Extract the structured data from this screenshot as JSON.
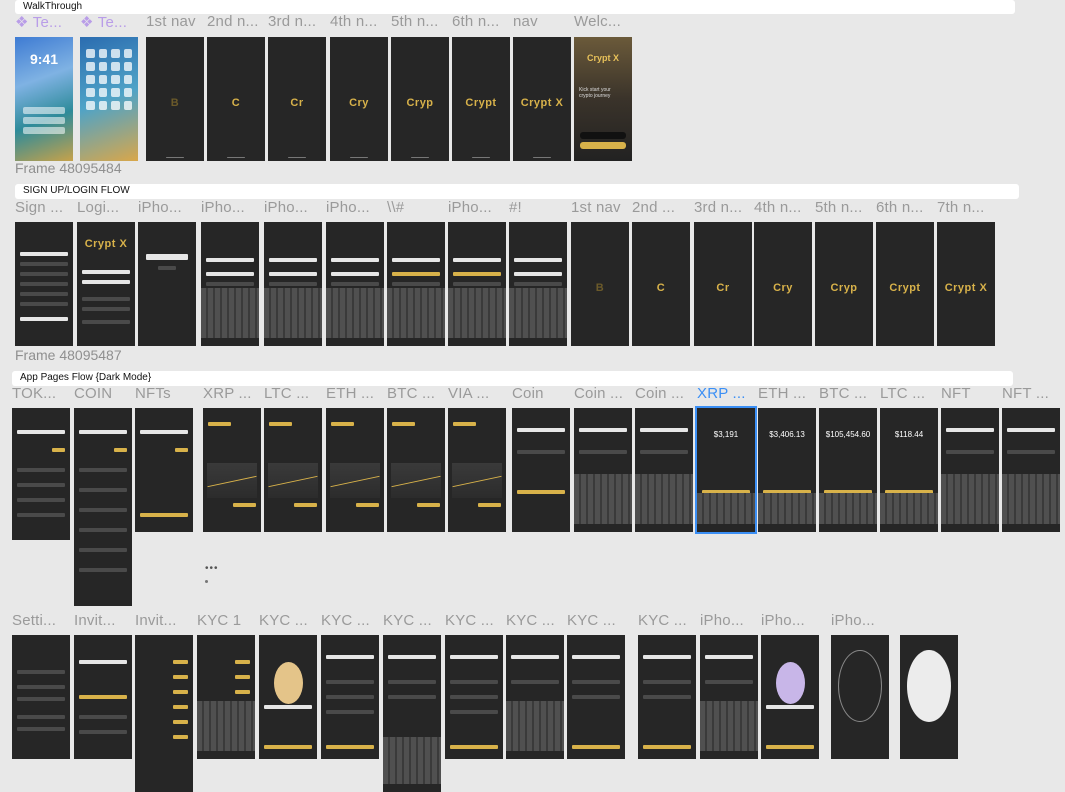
{
  "sections": {
    "walkthrough": "WalkThrough",
    "signup": "SIGN UP/LOGIN FLOW",
    "app": "App Pages Flow {Dark Mode}"
  },
  "frames": {
    "frame1": "Frame 48095484",
    "frame2": "Frame 48095487"
  },
  "labels": {
    "row1": [
      "❖ Te...",
      "❖ Te...",
      "1st nav",
      "2nd n...",
      "3rd n...",
      "4th n...",
      "5th n...",
      "6th n...",
      "nav",
      "Welc..."
    ],
    "row2": [
      "Sign ...",
      "Logi...",
      "iPho...",
      "iPho...",
      "iPho...",
      "iPho...",
      "\\\\#",
      "iPho...",
      "#!",
      "1st nav",
      "2nd ...",
      "3rd n...",
      "4th n...",
      "5th n...",
      "6th n...",
      "7th n..."
    ],
    "row3": [
      "TOK...",
      "COIN",
      "NFTs",
      "XRP ...",
      "LTC ...",
      "ETH ...",
      "BTC ...",
      "VIA ...",
      "Coin",
      "Coin ...",
      "Coin ...",
      "XRP ...",
      "ETH ...",
      "BTC ...",
      "LTC ...",
      "NFT",
      "NFT ..."
    ],
    "row4": [
      "Setti...",
      "Invit...",
      "Invit...",
      "KYC 1",
      "KYC ...",
      "KYC ...",
      "KYC ...",
      "KYC ...",
      "KYC ...",
      "KYC ...",
      "KYC ...",
      "iPho...",
      "iPho...",
      "iPho..."
    ]
  },
  "logos": {
    "l1": "C",
    "l2": "Cr",
    "l3": "Cry",
    "l4": "Cryp",
    "l5": "Crypt",
    "l6": "Crypt X"
  },
  "screens": {
    "lock_time": "9:41",
    "welcome_title": "Crypt X",
    "welcome_text": "Kick start your crypto journey",
    "amounts": [
      "$3,191",
      "$3,406.13",
      "$105,454.60",
      "$118.44"
    ],
    "dots": "•••"
  },
  "colors": {
    "accent": "#d8b24a",
    "selection": "#3b8ff5",
    "phone_bg": "#262626",
    "canvas_bg": "#e8e8e8"
  }
}
